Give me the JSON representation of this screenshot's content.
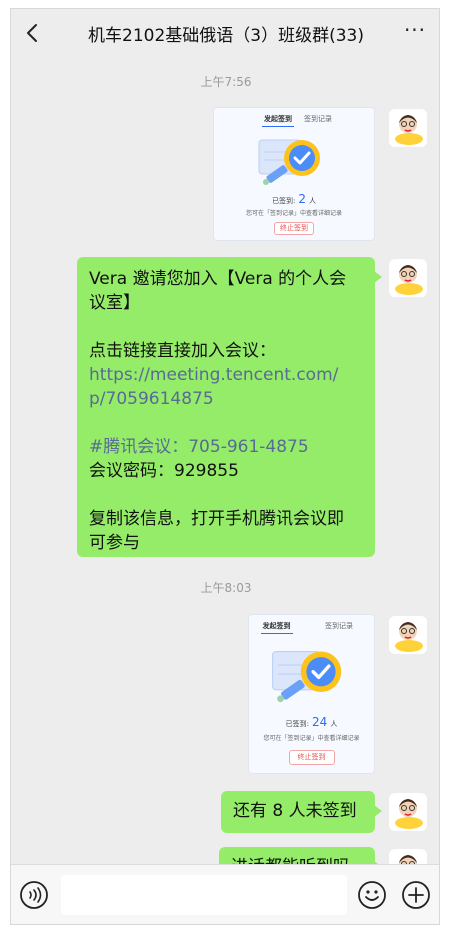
{
  "header": {
    "title": "机车2102基础俄语（3）班级群(33)",
    "more": "···"
  },
  "messages": {
    "time1": "上午7:56",
    "card1": {
      "tab_active": "发起签到",
      "tab_other": "签到记录",
      "signed_label": "已签到:",
      "signed_count": "2",
      "signed_unit": "人",
      "hint": "您可在「签到记录」中查看详细记录",
      "stop_button": "终止签到"
    },
    "invite": {
      "line1": "Vera 邀请您加入【Vera 的个人会",
      "line2": "议室】",
      "line3": "点击链接直接加入会议：",
      "link1": "https://meeting.tencent.com/",
      "link2": "p/7059614875",
      "tag": "#腾讯会议：705-961-4875",
      "password": "会议密码：929855",
      "line4": "复制该信息，打开手机腾讯会议即",
      "line5": "可参与"
    },
    "time2": "上午8:03",
    "card2": {
      "tab_active": "发起签到",
      "tab_other": "签到记录",
      "signed_label": "已签到:",
      "signed_count": "24",
      "signed_unit": "人",
      "hint": "您可在「签到记录」中查看详细记录",
      "stop_button": "终止签到"
    },
    "short1": "还有 8 人未签到",
    "short2": "进话都能听到吗"
  },
  "footer": {
    "input_placeholder": ""
  },
  "colors": {
    "bubble": "#95ec69",
    "background": "#ededed",
    "link": "#576b95",
    "accent": "#2d6cf6"
  }
}
